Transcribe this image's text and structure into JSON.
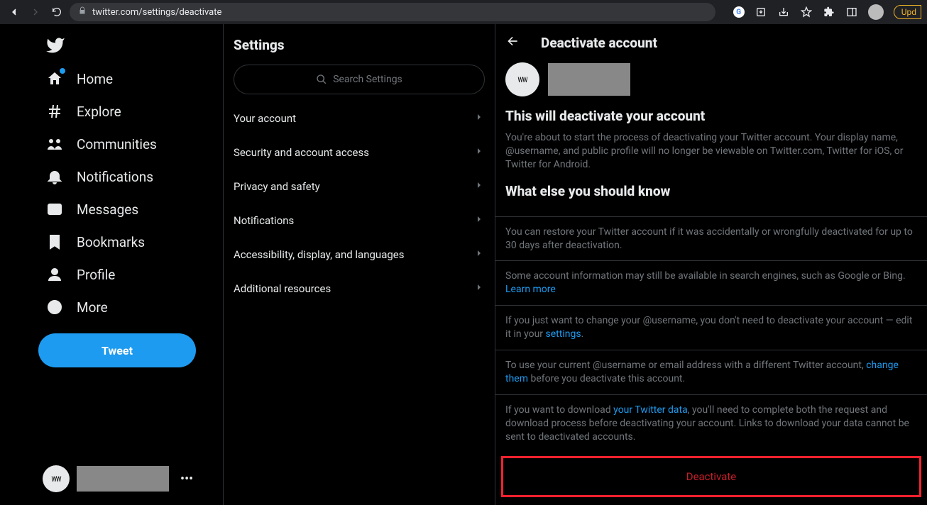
{
  "browser": {
    "url": "twitter.com/settings/deactivate",
    "update_label": "Upd"
  },
  "nav": {
    "items": [
      {
        "label": "Home"
      },
      {
        "label": "Explore"
      },
      {
        "label": "Communities"
      },
      {
        "label": "Notifications"
      },
      {
        "label": "Messages"
      },
      {
        "label": "Bookmarks"
      },
      {
        "label": "Profile"
      },
      {
        "label": "More"
      }
    ],
    "tweet_label": "Tweet"
  },
  "settings": {
    "title": "Settings",
    "search_placeholder": "Search Settings",
    "items": [
      {
        "label": "Your account"
      },
      {
        "label": "Security and account access"
      },
      {
        "label": "Privacy and safety"
      },
      {
        "label": "Notifications"
      },
      {
        "label": "Accessibility, display, and languages"
      },
      {
        "label": "Additional resources"
      }
    ]
  },
  "main": {
    "title": "Deactivate account",
    "section1_title": "This will deactivate your account",
    "section1_text": "You're about to start the process of deactivating your Twitter account. Your display name, @username, and public profile will no longer be viewable on Twitter.com, Twitter for iOS, or Twitter for Android.",
    "section2_title": "What else you should know",
    "info": [
      "You can restore your Twitter account if it was accidentally or wrongfully deactivated for up to 30 days after deactivation."
    ],
    "info_learn_pre": "Some account information may still be available in search engines, such as Google or Bing. ",
    "link_learn": "Learn more",
    "info_settings_pre": "If you just want to change your @username, you don't need to deactivate your account — edit it in your ",
    "link_settings": "settings",
    "info_change_pre": "To use your current @username or email address with a different Twitter account, ",
    "link_change": "change them",
    "info_change_post": " before you deactivate this account.",
    "info_data_pre": "If you want to download ",
    "link_data": "your Twitter data",
    "info_data_post": ", you'll need to complete both the request and download process before deactivating your account. Links to download your data cannot be sent to deactivated accounts.",
    "deactivate_label": "Deactivate"
  }
}
